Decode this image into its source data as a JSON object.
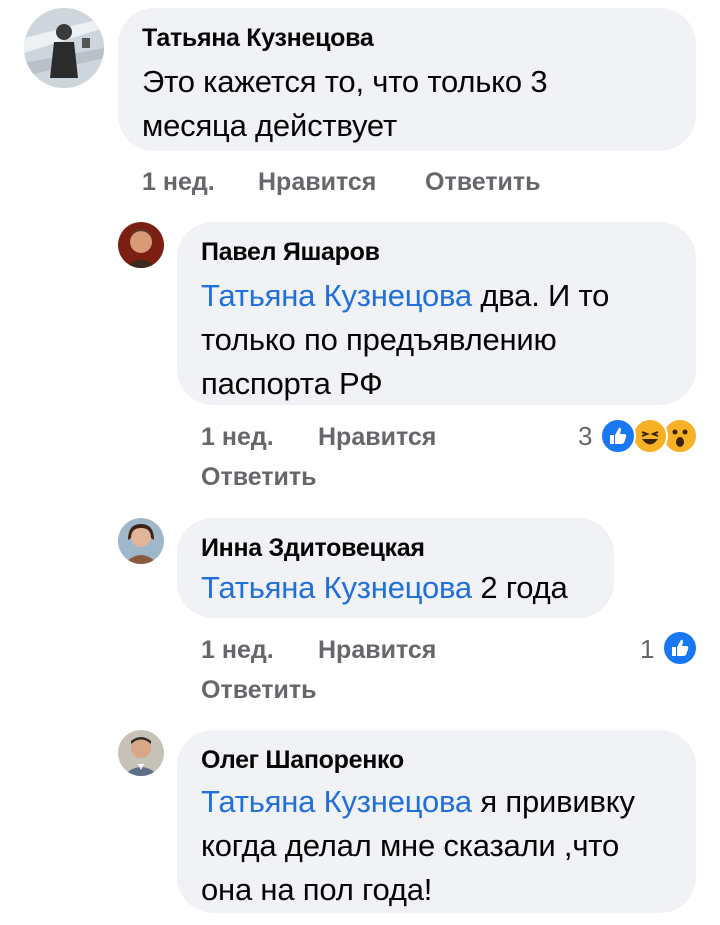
{
  "comments": [
    {
      "author": "Татьяна Кузнецова",
      "text_lines": [
        "Это кажется то, что только 3",
        "месяца действует"
      ],
      "time": "1 нед.",
      "like_label": "Нравится",
      "reply_label": "Ответить"
    },
    {
      "author": "Павел Яшаров",
      "mention": "Татьяна Кузнецова",
      "text_lines": [
        " два. И то",
        "только по предъявлению",
        "паспорта РФ"
      ],
      "time": "1 нед.",
      "like_label": "Нравится",
      "reply_label": "Ответить",
      "reaction_count": "3",
      "reactions": [
        "like-icon",
        "haha-icon",
        "wow-icon"
      ]
    },
    {
      "author": "Инна Здитовецкая",
      "mention": "Татьяна Кузнецова",
      "text_lines": [
        " 2 года"
      ],
      "time": "1 нед.",
      "like_label": "Нравится",
      "reply_label": "Ответить",
      "reaction_count": "1",
      "reactions": [
        "like-icon"
      ]
    },
    {
      "author": "Олег Шапоренко",
      "mention": "Татьяна Кузнецова",
      "text_lines": [
        " я прививку",
        "когда делал мне сказали ,что",
        "она на пол года!"
      ]
    }
  ],
  "colors": {
    "mention": "#216fdb",
    "meta": "#65676b",
    "bubble": "#f0f2f5",
    "like": "#1877f2",
    "emoji": "#f7b125"
  }
}
